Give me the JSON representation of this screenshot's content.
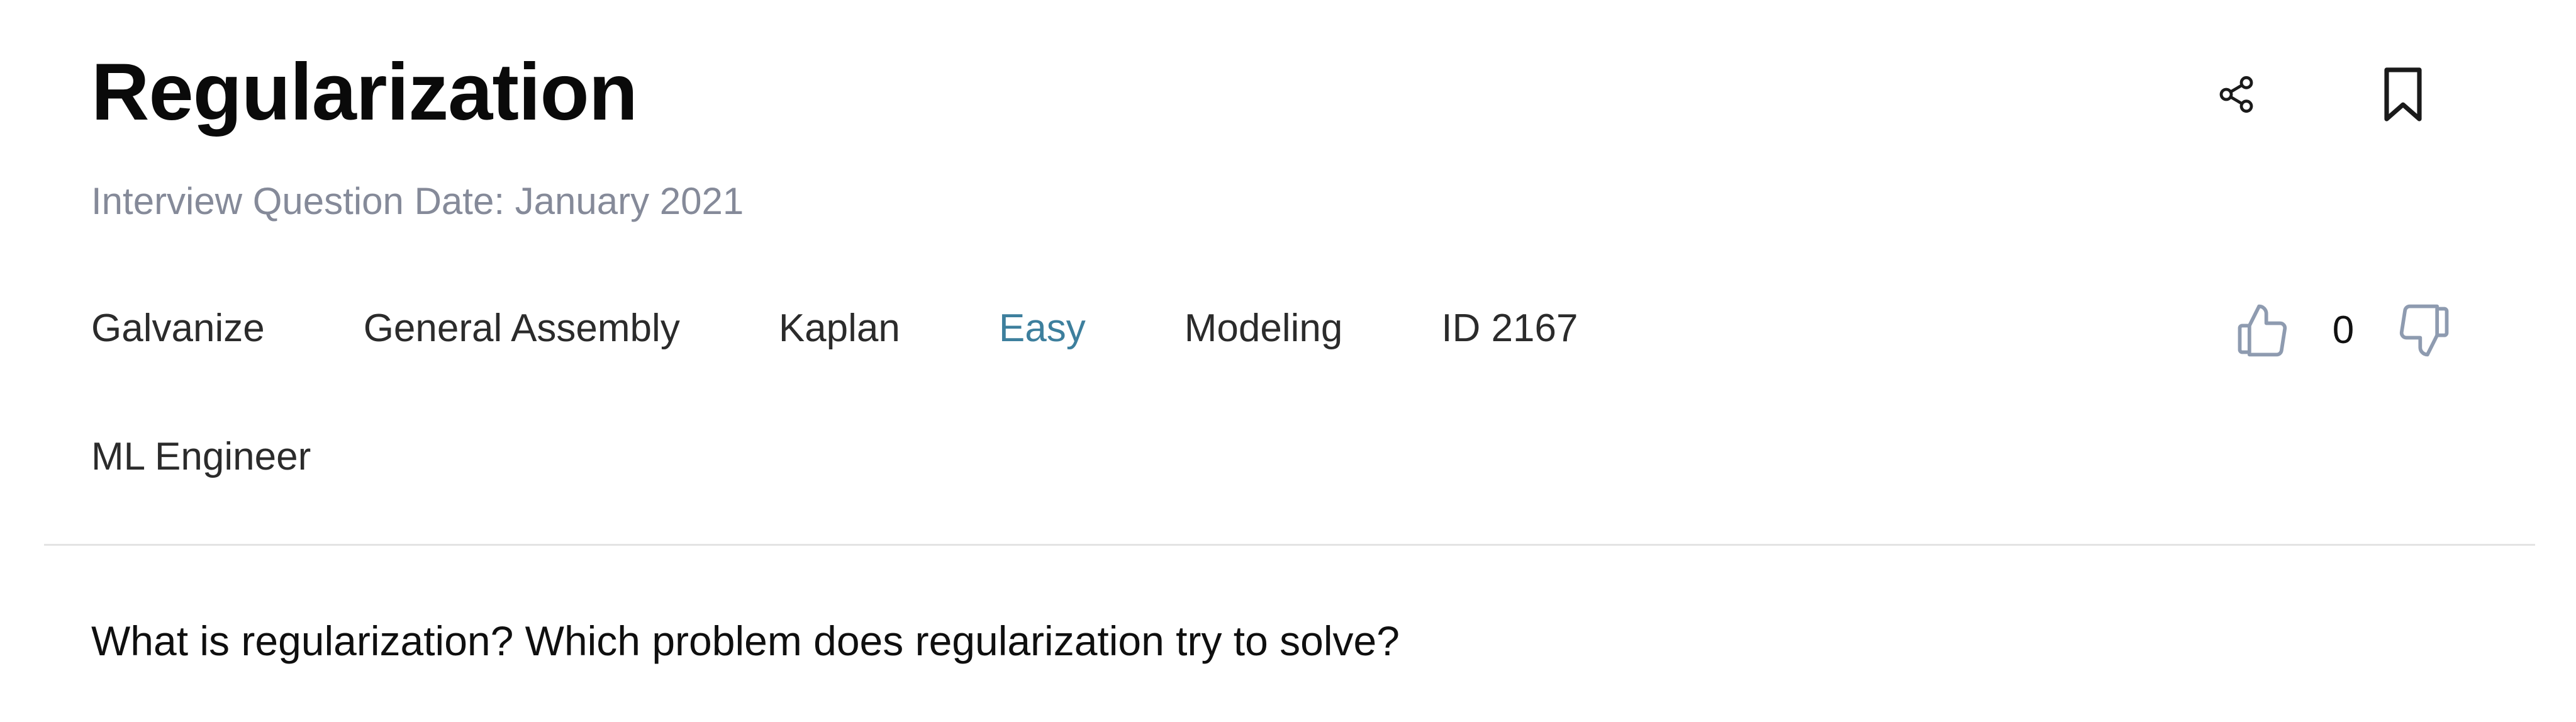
{
  "question": {
    "title": "Regularization",
    "date_label": "Interview Question Date: January 2021",
    "tags": {
      "company_1": "Galvanize",
      "company_2": "General Assembly",
      "company_3": "Kaplan",
      "difficulty": "Easy",
      "category": "Modeling",
      "id": "ID 2167"
    },
    "role": "ML Engineer",
    "votes": {
      "count": "0"
    },
    "body": "What is regularization? Which problem does regularization try to solve?"
  },
  "icons": {
    "share": "share-icon",
    "bookmark": "bookmark-icon",
    "thumbs_up": "thumbs-up-icon",
    "thumbs_down": "thumbs-down-icon"
  },
  "colors": {
    "title": "#0a0a0a",
    "muted_text": "#858a99",
    "difficulty_easy": "#3d7f9d",
    "vote_icon": "#8e9bb0",
    "divider": "#e3e3e3"
  }
}
